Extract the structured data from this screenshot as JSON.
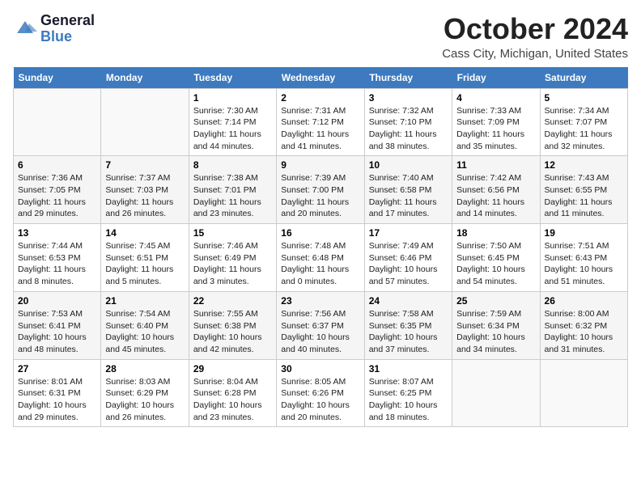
{
  "header": {
    "logo_line1": "General",
    "logo_line2": "Blue",
    "month": "October 2024",
    "location": "Cass City, Michigan, United States"
  },
  "weekdays": [
    "Sunday",
    "Monday",
    "Tuesday",
    "Wednesday",
    "Thursday",
    "Friday",
    "Saturday"
  ],
  "weeks": [
    [
      {
        "day": "",
        "info": ""
      },
      {
        "day": "",
        "info": ""
      },
      {
        "day": "1",
        "info": "Sunrise: 7:30 AM\nSunset: 7:14 PM\nDaylight: 11 hours\nand 44 minutes."
      },
      {
        "day": "2",
        "info": "Sunrise: 7:31 AM\nSunset: 7:12 PM\nDaylight: 11 hours\nand 41 minutes."
      },
      {
        "day": "3",
        "info": "Sunrise: 7:32 AM\nSunset: 7:10 PM\nDaylight: 11 hours\nand 38 minutes."
      },
      {
        "day": "4",
        "info": "Sunrise: 7:33 AM\nSunset: 7:09 PM\nDaylight: 11 hours\nand 35 minutes."
      },
      {
        "day": "5",
        "info": "Sunrise: 7:34 AM\nSunset: 7:07 PM\nDaylight: 11 hours\nand 32 minutes."
      }
    ],
    [
      {
        "day": "6",
        "info": "Sunrise: 7:36 AM\nSunset: 7:05 PM\nDaylight: 11 hours\nand 29 minutes."
      },
      {
        "day": "7",
        "info": "Sunrise: 7:37 AM\nSunset: 7:03 PM\nDaylight: 11 hours\nand 26 minutes."
      },
      {
        "day": "8",
        "info": "Sunrise: 7:38 AM\nSunset: 7:01 PM\nDaylight: 11 hours\nand 23 minutes."
      },
      {
        "day": "9",
        "info": "Sunrise: 7:39 AM\nSunset: 7:00 PM\nDaylight: 11 hours\nand 20 minutes."
      },
      {
        "day": "10",
        "info": "Sunrise: 7:40 AM\nSunset: 6:58 PM\nDaylight: 11 hours\nand 17 minutes."
      },
      {
        "day": "11",
        "info": "Sunrise: 7:42 AM\nSunset: 6:56 PM\nDaylight: 11 hours\nand 14 minutes."
      },
      {
        "day": "12",
        "info": "Sunrise: 7:43 AM\nSunset: 6:55 PM\nDaylight: 11 hours\nand 11 minutes."
      }
    ],
    [
      {
        "day": "13",
        "info": "Sunrise: 7:44 AM\nSunset: 6:53 PM\nDaylight: 11 hours\nand 8 minutes."
      },
      {
        "day": "14",
        "info": "Sunrise: 7:45 AM\nSunset: 6:51 PM\nDaylight: 11 hours\nand 5 minutes."
      },
      {
        "day": "15",
        "info": "Sunrise: 7:46 AM\nSunset: 6:49 PM\nDaylight: 11 hours\nand 3 minutes."
      },
      {
        "day": "16",
        "info": "Sunrise: 7:48 AM\nSunset: 6:48 PM\nDaylight: 11 hours\nand 0 minutes."
      },
      {
        "day": "17",
        "info": "Sunrise: 7:49 AM\nSunset: 6:46 PM\nDaylight: 10 hours\nand 57 minutes."
      },
      {
        "day": "18",
        "info": "Sunrise: 7:50 AM\nSunset: 6:45 PM\nDaylight: 10 hours\nand 54 minutes."
      },
      {
        "day": "19",
        "info": "Sunrise: 7:51 AM\nSunset: 6:43 PM\nDaylight: 10 hours\nand 51 minutes."
      }
    ],
    [
      {
        "day": "20",
        "info": "Sunrise: 7:53 AM\nSunset: 6:41 PM\nDaylight: 10 hours\nand 48 minutes."
      },
      {
        "day": "21",
        "info": "Sunrise: 7:54 AM\nSunset: 6:40 PM\nDaylight: 10 hours\nand 45 minutes."
      },
      {
        "day": "22",
        "info": "Sunrise: 7:55 AM\nSunset: 6:38 PM\nDaylight: 10 hours\nand 42 minutes."
      },
      {
        "day": "23",
        "info": "Sunrise: 7:56 AM\nSunset: 6:37 PM\nDaylight: 10 hours\nand 40 minutes."
      },
      {
        "day": "24",
        "info": "Sunrise: 7:58 AM\nSunset: 6:35 PM\nDaylight: 10 hours\nand 37 minutes."
      },
      {
        "day": "25",
        "info": "Sunrise: 7:59 AM\nSunset: 6:34 PM\nDaylight: 10 hours\nand 34 minutes."
      },
      {
        "day": "26",
        "info": "Sunrise: 8:00 AM\nSunset: 6:32 PM\nDaylight: 10 hours\nand 31 minutes."
      }
    ],
    [
      {
        "day": "27",
        "info": "Sunrise: 8:01 AM\nSunset: 6:31 PM\nDaylight: 10 hours\nand 29 minutes."
      },
      {
        "day": "28",
        "info": "Sunrise: 8:03 AM\nSunset: 6:29 PM\nDaylight: 10 hours\nand 26 minutes."
      },
      {
        "day": "29",
        "info": "Sunrise: 8:04 AM\nSunset: 6:28 PM\nDaylight: 10 hours\nand 23 minutes."
      },
      {
        "day": "30",
        "info": "Sunrise: 8:05 AM\nSunset: 6:26 PM\nDaylight: 10 hours\nand 20 minutes."
      },
      {
        "day": "31",
        "info": "Sunrise: 8:07 AM\nSunset: 6:25 PM\nDaylight: 10 hours\nand 18 minutes."
      },
      {
        "day": "",
        "info": ""
      },
      {
        "day": "",
        "info": ""
      }
    ]
  ]
}
